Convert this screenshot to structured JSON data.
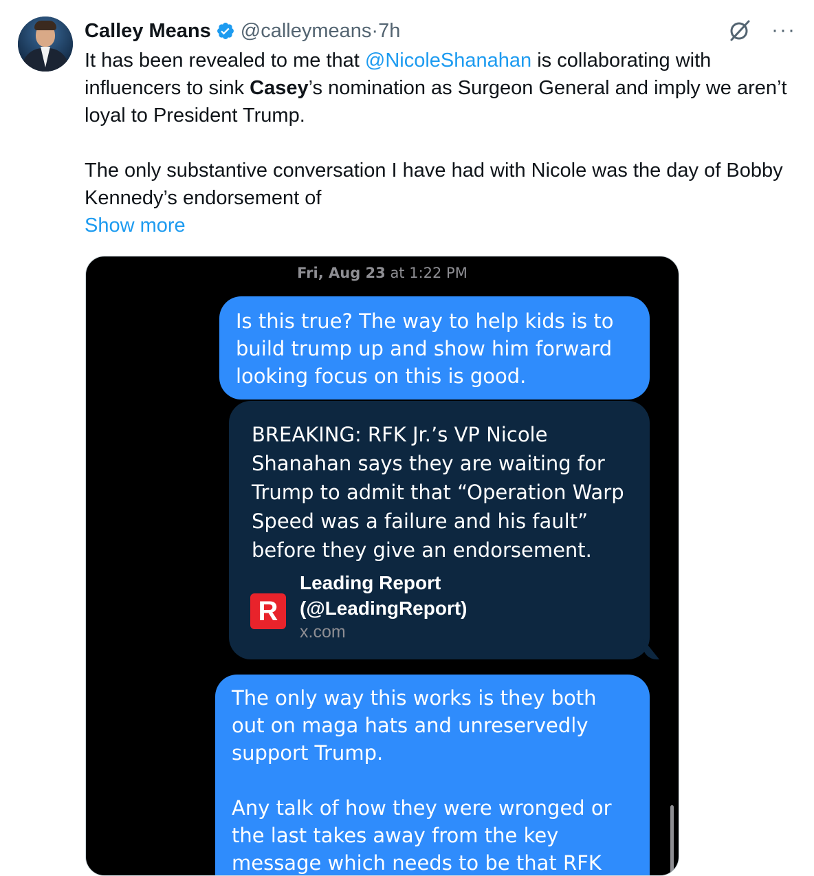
{
  "tweet": {
    "author_name": "Calley Means",
    "author_handle": "@calleymeans",
    "separator": " · ",
    "time": "7h",
    "more_label": "···",
    "text_part1": "It has been revealed to me that ",
    "mention": "@NicoleShanahan",
    "text_part2": " is collaborating with influencers to sink ",
    "bold_name": "Casey",
    "text_part3": "’s nomination as Surgeon General and imply we aren’t loyal to President Trump.",
    "paragraph2": "The only substantive conversation I have had with Nicole was the day of Bobby Kennedy’s endorsement of",
    "show_more": "Show more"
  },
  "messages": {
    "timestamp_day": "Fri, Aug 23",
    "timestamp_time": " at 1:22 PM",
    "bubble1": "Is this true? The way to help kids is to build trump up and show him forward looking focus on this is good.",
    "card_text": "BREAKING: RFK Jr.’s VP Nicole Shanahan says they are waiting for Trump to admit that “Operation Warp Speed was a failure and his fault” before they give an endorsement.",
    "card_source_name": "Leading Report",
    "card_source_handle": "(@LeadingReport)",
    "card_domain": "x.com",
    "card_logo_letter": "R",
    "bubble2_p1": "The only way this works is they both out on maga hats and unreservedly support Trump.",
    "bubble2_p2": "Any talk of how they were wronged or the last takes away from the key message which needs to be that RFK"
  },
  "colors": {
    "link": "#1d9bf0",
    "imessage_blue": "#2f8cfc",
    "card_bg": "#0d2740",
    "logo_red": "#e8232b"
  }
}
